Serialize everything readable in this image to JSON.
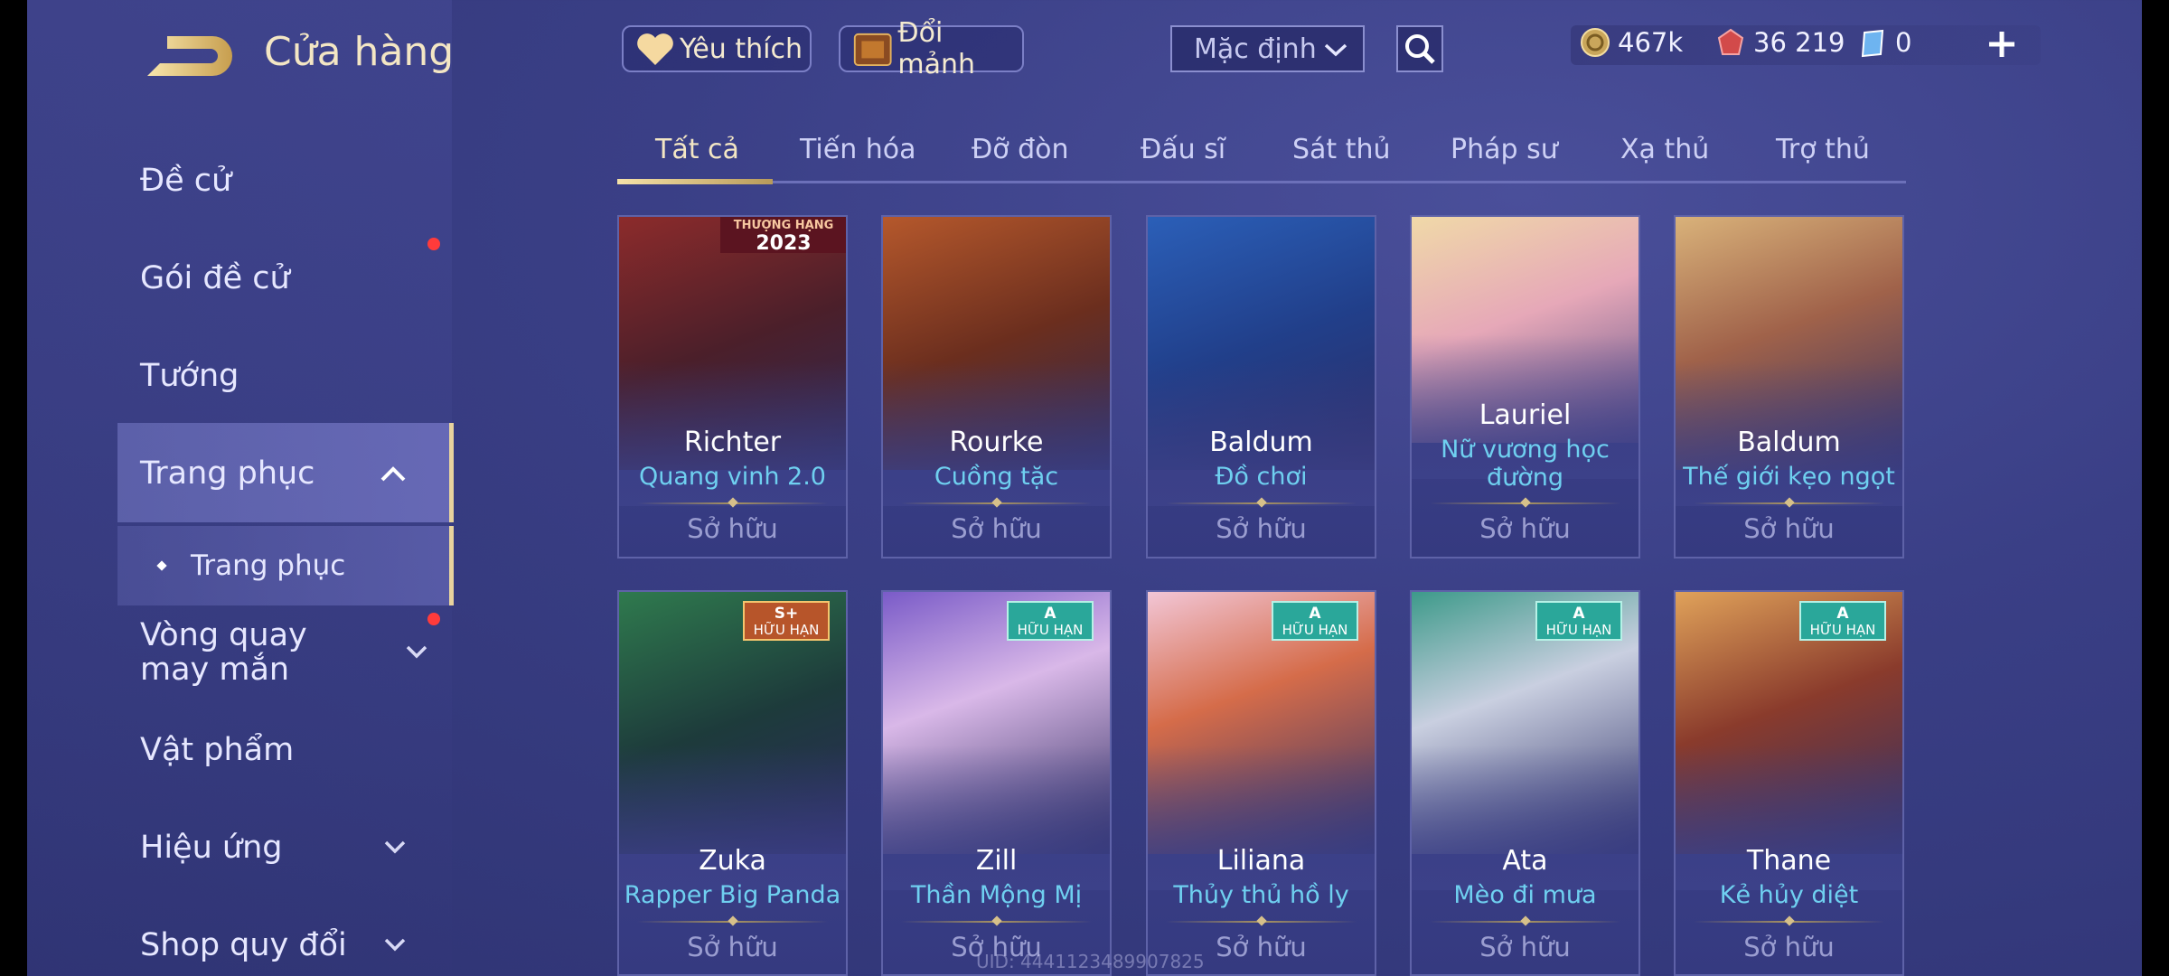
{
  "header": {
    "title": "Cửa hàng",
    "back_icon": "back-arrow-icon"
  },
  "sidebar": {
    "items": [
      {
        "label": "Đề cử",
        "has_dot": false
      },
      {
        "label": "Gói đề cử",
        "has_dot": true
      },
      {
        "label": "Tướng",
        "has_dot": false
      },
      {
        "label": "Trang phục",
        "expanded": true,
        "active": true
      },
      {
        "label": "Trang phục",
        "sub": true,
        "active": true
      },
      {
        "label": "Vòng quay may mắn",
        "has_dot": true
      },
      {
        "label": "Vật phẩm"
      },
      {
        "label": "Hiệu ứng"
      },
      {
        "label": "Shop quy đổi"
      }
    ]
  },
  "topbar": {
    "favorite_label": "Yêu thích",
    "exchange_label": "Đổi mảnh",
    "sort_value": "Mặc định",
    "currency": {
      "gold": "467k",
      "vouchers": "36 219",
      "tickets": "0"
    }
  },
  "tabs": [
    "Tất cả",
    "Tiến hóa",
    "Đỡ đòn",
    "Đấu sĩ",
    "Sát thủ",
    "Pháp sư",
    "Xạ thủ",
    "Trợ thủ"
  ],
  "cards": [
    {
      "hero": "Richter",
      "skin": "Quang vinh 2.0",
      "status": "Sở hữu",
      "ribbon": "2023",
      "ribbon_sub": "THƯỢNG HẠNG"
    },
    {
      "hero": "Rourke",
      "skin": "Cuồng tặc",
      "status": "Sở hữu"
    },
    {
      "hero": "Baldum",
      "skin": "Đồ chơi",
      "status": "Sở hữu"
    },
    {
      "hero": "Lauriel",
      "skin": "Nữ vương học đường",
      "status": "Sở hữu"
    },
    {
      "hero": "Baldum",
      "skin": "Thế giới kẹo ngọt",
      "status": "Sở hữu"
    },
    {
      "hero": "Zuka",
      "skin": "Rapper Big Panda",
      "status": "Sở hữu",
      "tier": "S+",
      "tier_sub": "HỮU HẠN"
    },
    {
      "hero": "Zill",
      "skin": "Thần Mộng Mị",
      "status": "Sở hữu",
      "tier": "A",
      "tier_sub": "HỮU HẠN"
    },
    {
      "hero": "Liliana",
      "skin": "Thủy thủ hồ ly",
      "status": "Sở hữu",
      "tier": "A",
      "tier_sub": "HỮU HẠN"
    },
    {
      "hero": "Ata",
      "skin": "Mèo đi mưa",
      "status": "Sở hữu",
      "tier": "A",
      "tier_sub": "HỮU HẠN"
    },
    {
      "hero": "Thane",
      "skin": "Kẻ hủy diệt",
      "status": "Sở hữu",
      "tier": "A",
      "tier_sub": "HỮU HẠN"
    }
  ],
  "footer": {
    "uid": "UID: 4441123489907825"
  }
}
